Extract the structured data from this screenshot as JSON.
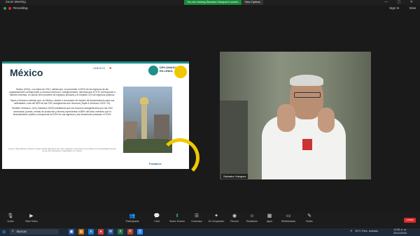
{
  "window": {
    "title": "Zoom Meeting"
  },
  "share_banner": {
    "message": "You are viewing Salvador Vázquez's screen",
    "options_label": "View Options"
  },
  "status": {
    "recording": "Recording"
  },
  "top_right": {
    "signin": "Sign In",
    "view": "View"
  },
  "slide": {
    "title": "México",
    "logo_1": "UNESCO",
    "logo_2": "DIPLOMADO",
    "diploma_line1": "DIPLOMADO",
    "diploma_line2": "EN LÍNEA",
    "paragraphs": [
      "Muñoz (2014), con datos de 2011, señala que, en promedio, el 60% de los ingresos de las organizaciones corresponden a recursos internos o autogenerados, mientras que el 47% corresponde a fuentes externas, en donde 36% proviene de ingresos privados y el restante 11% de ingresos públicos.",
      "Tapia y Verduzco estiman que, en México, debido a la escasez de fuentes de financiamiento para sus actividades, más del 80% de las OSC autogeneran sus recursos (Tapia & Verduzco 2013: 19).",
      "También Verduzco, List y Salamon (2002) establecen que los recursos autogenerados por las OSC mexicanas (cuotas, ventas de productos y bienes) representan el 85% del total, mientras que el financiamiento público corresponde al 8.5% de sus ingresos y las donaciones privadas, el 6.5%."
    ],
    "source": "Fuentes: Tapia, Mónica y Verduzco, Gustavo (2013). Diagnóstico del marco regulatorio y otros factores que inciden en la sostenibilidad financiera de las OSC. Alternativas y Capacidades, A.C. México.",
    "footer": "Fortalece"
  },
  "video": {
    "participant_name": "Salvador Vázquez"
  },
  "toolbar": {
    "items": [
      {
        "label": "Audio",
        "icon": "microphone-icon"
      },
      {
        "label": "Start Video",
        "icon": "video-icon"
      },
      {
        "label": "Participants",
        "icon": "participants-icon",
        "badge": "41"
      },
      {
        "label": "Chat",
        "icon": "chat-icon"
      },
      {
        "label": "Share Screen",
        "icon": "share-icon"
      },
      {
        "label": "Summary",
        "icon": "summary-icon"
      },
      {
        "label": "AI Companion",
        "icon": "ai-companion-icon"
      },
      {
        "label": "Record",
        "icon": "record-icon"
      },
      {
        "label": "Reactions",
        "icon": "reactions-icon"
      },
      {
        "label": "Apps",
        "icon": "apps-icon"
      },
      {
        "label": "Whiteboards",
        "icon": "whiteboard-icon"
      },
      {
        "label": "Notes",
        "icon": "notes-icon"
      }
    ],
    "leave_label": "Leave"
  },
  "taskbar": {
    "search_label": "Buscar",
    "weather": "30°C Parc. soleado",
    "time": "11:56 a. m.",
    "date": "25/10/2023"
  }
}
